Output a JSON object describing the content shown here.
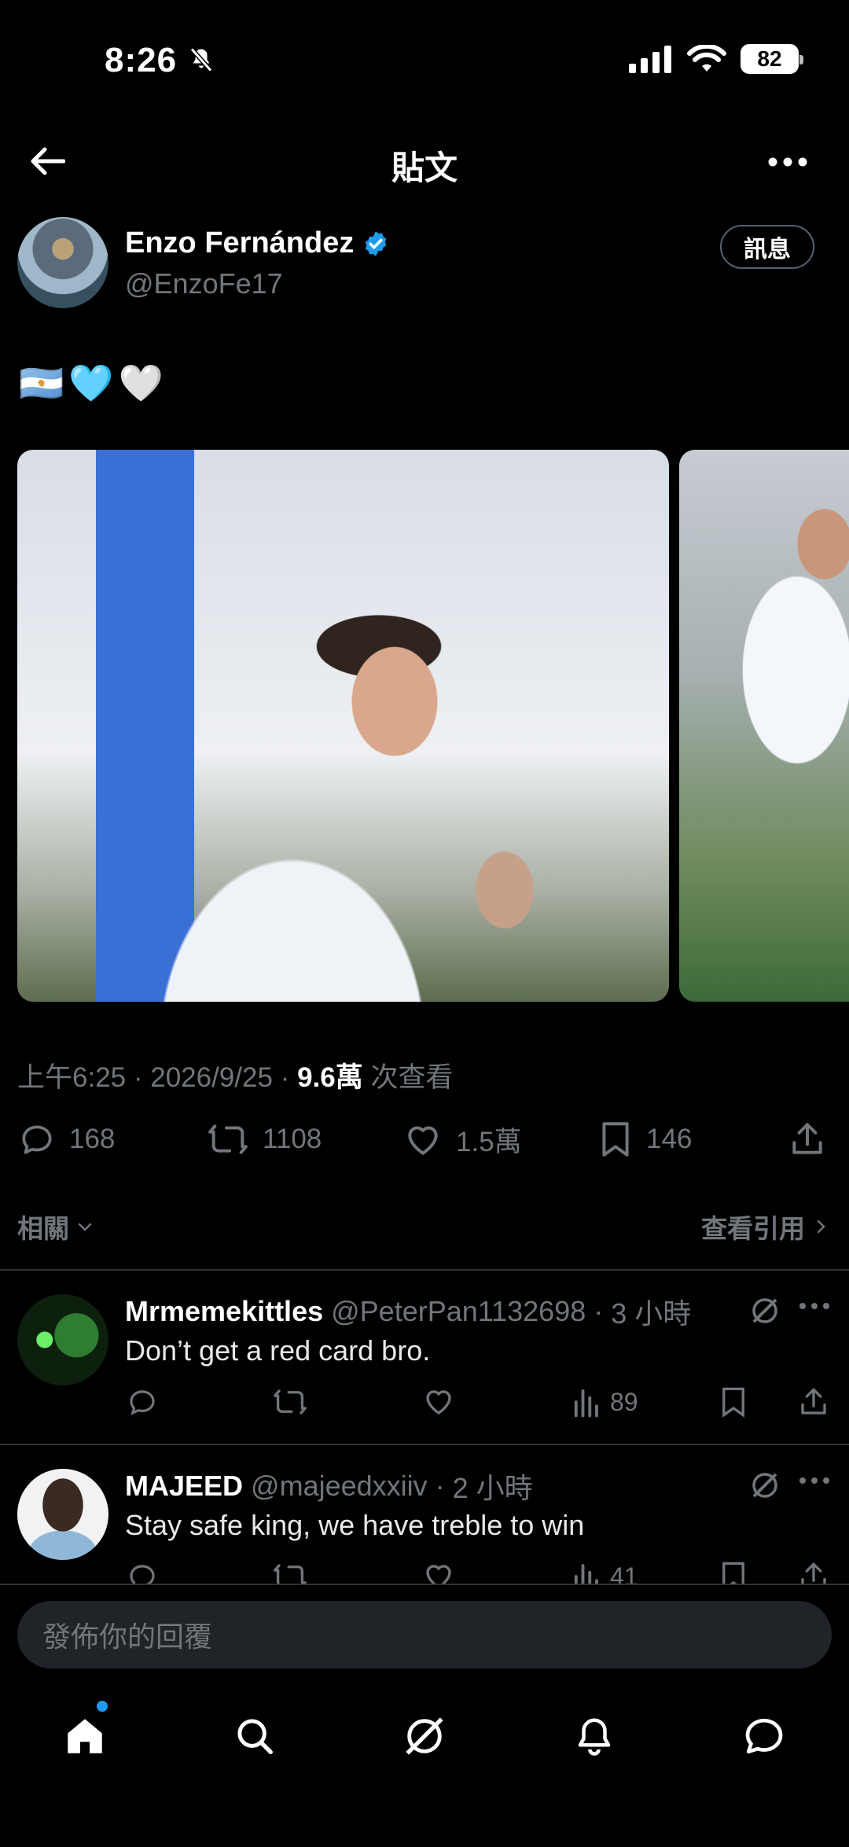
{
  "status": {
    "time": "8:26",
    "battery": "82"
  },
  "header": {
    "title": "貼文"
  },
  "author": {
    "name": "Enzo Fernández",
    "handle": "@EnzoFe17",
    "message_button": "訊息"
  },
  "tweet": {
    "emojis": [
      "🇦🇷",
      "🩵",
      "🤍"
    ]
  },
  "meta": {
    "time": "上午6:25",
    "sep1": "·",
    "date": "2026/9/25",
    "sep2": "·",
    "views": "9.6萬",
    "views_label": "次查看"
  },
  "stats": {
    "replies": "168",
    "retweets": "1108",
    "likes": "1.5萬",
    "bookmarks": "146"
  },
  "filters": {
    "related": "相關",
    "quotes": "查看引用"
  },
  "replies": [
    {
      "name": "Mrmemekittles",
      "handle": "@PeterPan1132698",
      "sep": "·",
      "time": "3 小時",
      "text": "Don’t get a red card bro.",
      "views": "89"
    },
    {
      "name": "MAJEED",
      "handle": "@majeedxxiiv",
      "sep": "·",
      "time": "2 小時",
      "text": "Stay safe king, we have treble to win",
      "views": "41"
    }
  ],
  "composer": {
    "placeholder": "發佈你的回覆"
  },
  "colors": {
    "accent": "#1d9bf0",
    "muted": "#71767b",
    "background": "#000000"
  }
}
